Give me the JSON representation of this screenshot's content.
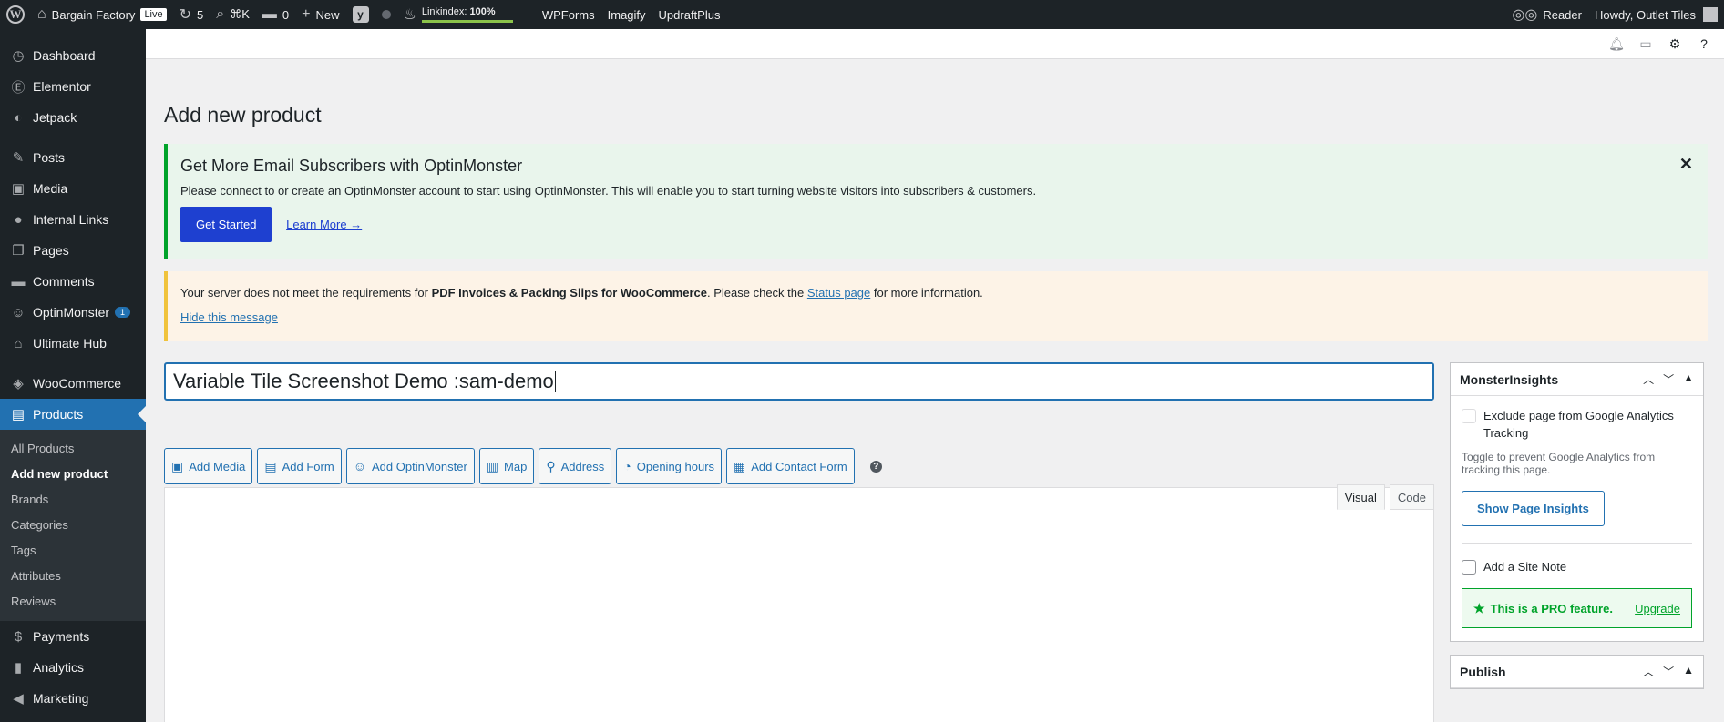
{
  "admin_bar": {
    "site_name": "Bargain Factory",
    "live_badge": "Live",
    "updates_count": "5",
    "search_shortcut": "⌘K",
    "comments_count": "0",
    "new_label": "New",
    "linkindex_label": "Linkindex:",
    "linkindex_value": "100%",
    "plugins": [
      "WPForms",
      "Imagify",
      "UpdraftPlus"
    ],
    "reader_label": "Reader",
    "howdy": "Howdy, Outlet Tiles"
  },
  "sidebar": {
    "items": [
      {
        "label": "Dashboard",
        "icon": "dashboard-icon",
        "glyph": "◷"
      },
      {
        "label": "Elementor",
        "icon": "elementor-icon",
        "glyph": "Ⓔ"
      },
      {
        "label": "Jetpack",
        "icon": "jetpack-icon",
        "glyph": "◐"
      },
      {
        "label": "Posts",
        "icon": "pin-icon",
        "glyph": "✎"
      },
      {
        "label": "Media",
        "icon": "media-icon",
        "glyph": "▣"
      },
      {
        "label": "Internal Links",
        "icon": "internal-links-icon",
        "glyph": "●"
      },
      {
        "label": "Pages",
        "icon": "pages-icon",
        "glyph": "❐"
      },
      {
        "label": "Comments",
        "icon": "comments-icon",
        "glyph": "▬"
      },
      {
        "label": "OptinMonster",
        "icon": "optinmonster-icon",
        "glyph": "☺",
        "badge": "1"
      },
      {
        "label": "Ultimate Hub",
        "icon": "hub-icon",
        "glyph": "⌂"
      },
      {
        "label": "WooCommerce",
        "icon": "woocommerce-icon",
        "glyph": "◈"
      },
      {
        "label": "Products",
        "icon": "products-icon",
        "glyph": "▤"
      },
      {
        "label": "Payments",
        "icon": "payments-icon",
        "glyph": "$"
      },
      {
        "label": "Analytics",
        "icon": "analytics-icon",
        "glyph": "▮"
      },
      {
        "label": "Marketing",
        "icon": "marketing-icon",
        "glyph": "◀"
      }
    ],
    "submenu": [
      "All Products",
      "Add new product",
      "Brands",
      "Categories",
      "Tags",
      "Attributes",
      "Reviews"
    ]
  },
  "page": {
    "title": "Add new product"
  },
  "optin_notice": {
    "heading": "Get More Email Subscribers with OptinMonster",
    "text": "Please connect to or create an OptinMonster account to start using OptinMonster. This will enable you to start turning website visitors into subscribers & customers.",
    "button": "Get Started",
    "link": "Learn More →"
  },
  "warn_notice": {
    "text_before": "Your server does not meet the requirements for ",
    "bold": "PDF Invoices & Packing Slips for WooCommerce",
    "text_middle": ". Please check the ",
    "link": "Status page",
    "text_after": " for more information.",
    "hide": "Hide this message"
  },
  "editor": {
    "title_value": "Variable Tile Screenshot Demo :sam-demo",
    "media_buttons": [
      "Add Media",
      "Add Form",
      "Add OptinMonster",
      "Map",
      "Address",
      "Opening hours",
      "Add Contact Form"
    ],
    "tab_visual": "Visual",
    "tab_code": "Code"
  },
  "monsterinsights": {
    "title": "MonsterInsights",
    "exclude_label": "Exclude page from Google Analytics Tracking",
    "hint": "Toggle to prevent Google Analytics from tracking this page.",
    "insights_button": "Show Page Insights",
    "site_note": "Add a Site Note",
    "pro_text": "This is a PRO feature.",
    "upgrade": "Upgrade"
  },
  "publish": {
    "title": "Publish"
  }
}
